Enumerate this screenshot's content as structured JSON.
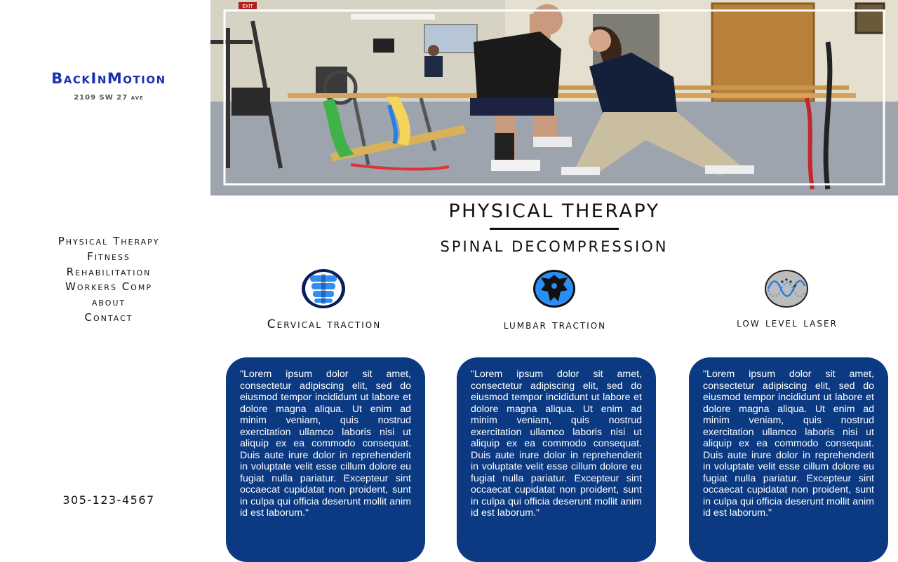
{
  "sidebar": {
    "brand": "BackInMotion",
    "address": "2109 SW 27 ave",
    "nav": [
      "Physical Therapy",
      "Fitness",
      "Rehabilitation",
      "Workers Comp",
      "about",
      "Contact"
    ],
    "phone": "305-123-4567"
  },
  "hero": {
    "exit_sign": "EXIT"
  },
  "main": {
    "title": "PHYSICAL THERAPY",
    "subtitle": "SPINAL DECOMPRESSION",
    "features": [
      {
        "icon": "cervical-spine-icon",
        "title": "Cervical traction",
        "text": "\"Lorem ipsum dolor sit amet, consectetur adipiscing elit, sed do eiusmod tempor incididunt ut labore et dolore magna aliqua. Ut enim ad minim veniam, quis nostrud exercitation ullamco laboris nisi ut aliquip ex ea commodo consequat. Duis aute irure dolor in reprehenderit in voluptate velit esse cillum dolore eu fugiat nulla pariatur. Excepteur sint occaecat cupidatat non proident, sunt in culpa qui officia deserunt mollit anim id est laborum.\""
      },
      {
        "icon": "lumbar-vertebra-icon",
        "title": "lumbar traction",
        "text": "\"Lorem ipsum dolor sit amet, consectetur adipiscing elit, sed do eiusmod tempor incididunt ut labore et dolore magna aliqua. Ut enim ad minim veniam, quis nostrud exercitation ullamco laboris nisi ut aliquip ex ea commodo consequat. Duis aute irure dolor in reprehenderit in voluptate velit esse cillum dolore eu fugiat nulla pariatur. Excepteur sint occaecat cupidatat non proident, sunt in culpa qui officia deserunt mollit anim id est laborum.\""
      },
      {
        "icon": "laser-wave-icon",
        "title": "low level laser",
        "text": "\"Lorem ipsum dolor sit amet, consectetur adipiscing elit, sed do eiusmod tempor incididunt ut labore et dolore magna aliqua. Ut enim ad minim veniam, quis nostrud exercitation ullamco laboris nisi ut aliquip ex ea commodo consequat. Duis aute irure dolor in reprehenderit in voluptate velit esse cillum dolore eu fugiat nulla pariatur. Excepteur sint occaecat cupidatat non proident, sunt in culpa qui officia deserunt mollit anim id est laborum.\""
      }
    ]
  },
  "colors": {
    "brand": "#1a2fb0",
    "card": "#0b3a82",
    "icon_blue": "#2a7ee0"
  }
}
